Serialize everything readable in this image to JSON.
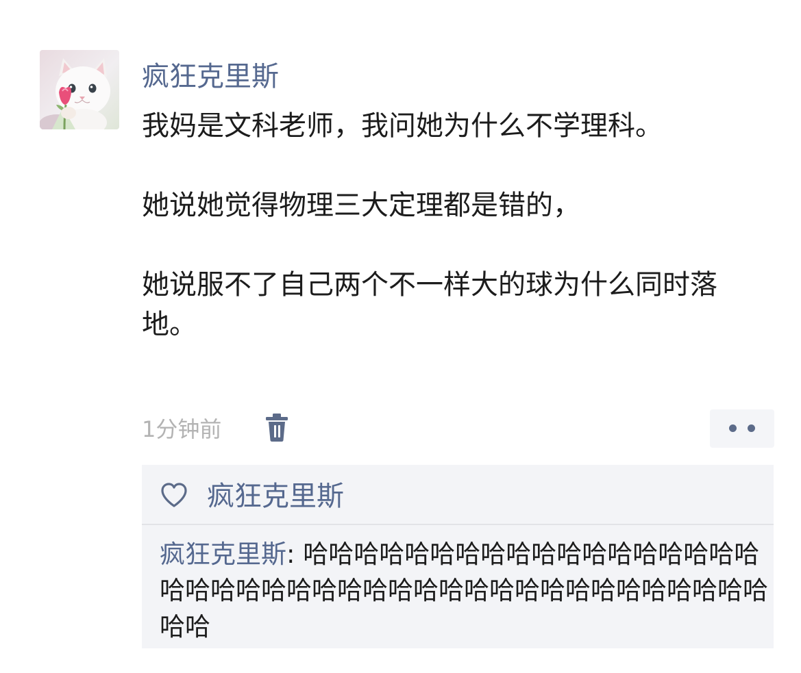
{
  "post": {
    "username": "疯狂克里斯",
    "paragraphs": [
      "我妈是文科老师，我问她为什么不学理科。",
      "她说她觉得物理三大定理都是错的，",
      "她说服不了自己两个不一样大的球为什么同时落地。"
    ],
    "timestamp": "1分钟前",
    "icons": {
      "delete": "trash-icon",
      "more": "more-dots-icon",
      "like": "heart-icon",
      "avatar": "cat-avatar"
    }
  },
  "likes": {
    "names": "疯狂克里斯"
  },
  "comments": [
    {
      "author": "疯狂克里斯",
      "separator": ": ",
      "text": "哈哈哈哈哈哈哈哈哈哈哈哈哈哈哈哈哈哈哈哈哈哈哈哈哈哈哈哈哈哈哈哈哈哈哈哈哈哈哈哈哈哈哈哈"
    }
  ],
  "colors": {
    "link_blue": "#55688f",
    "text": "#1c1c1c",
    "muted": "#b3b3b3",
    "panel_bg": "#f3f4f7"
  }
}
